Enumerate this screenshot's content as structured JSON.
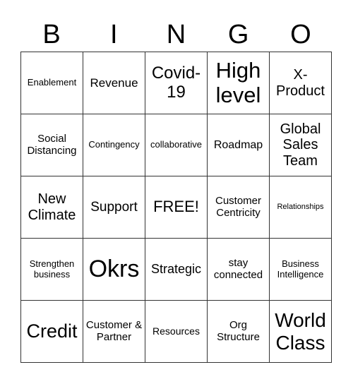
{
  "header": [
    "B",
    "I",
    "N",
    "G",
    "O"
  ],
  "cells": [
    {
      "text": "Enablement",
      "size": 13
    },
    {
      "text": "Revenue",
      "size": 17
    },
    {
      "text": "Covid-19",
      "size": 24
    },
    {
      "text": "High level",
      "size": 31
    },
    {
      "text": "X-Product",
      "size": 20
    },
    {
      "text": "Social Distancing",
      "size": 15
    },
    {
      "text": "Contingency",
      "size": 13
    },
    {
      "text": "collaborative",
      "size": 13
    },
    {
      "text": "Roadmap",
      "size": 16
    },
    {
      "text": "Global Sales Team",
      "size": 20
    },
    {
      "text": "New Climate",
      "size": 20
    },
    {
      "text": "Support",
      "size": 19
    },
    {
      "text": "FREE!",
      "size": 22
    },
    {
      "text": "Customer Centricity",
      "size": 15
    },
    {
      "text": "Relationships",
      "size": 11
    },
    {
      "text": "Strengthen business",
      "size": 13
    },
    {
      "text": "Okrs",
      "size": 34
    },
    {
      "text": "Strategic",
      "size": 18
    },
    {
      "text": "stay connected",
      "size": 15
    },
    {
      "text": "Business Intelligence",
      "size": 13
    },
    {
      "text": "Credit",
      "size": 27
    },
    {
      "text": "Customer & Partner",
      "size": 15
    },
    {
      "text": "Resources",
      "size": 14
    },
    {
      "text": "Org Structure",
      "size": 15
    },
    {
      "text": "World Class",
      "size": 28
    }
  ]
}
